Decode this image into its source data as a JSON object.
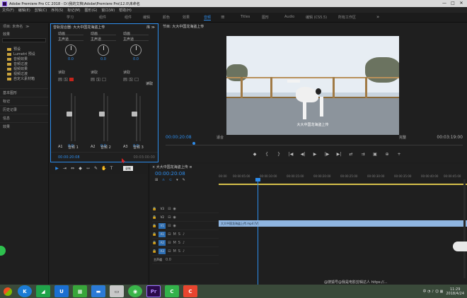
{
  "window": {
    "title": "Adobe Premiere Pro CC 2018 - D:\\我的文档\\Adobe\\Premiere Pro\\12.0\\未命名",
    "controls": [
      "—",
      "□",
      "✕"
    ]
  },
  "menu": [
    "文件(F)",
    "编辑(E)",
    "剪辑(C)",
    "序列(S)",
    "标记(M)",
    "图形(G)",
    "窗口(W)",
    "帮助(H)"
  ],
  "workspaces": {
    "items": [
      "组件",
      "编辑",
      "颜色",
      "效果",
      "音频",
      "Titles",
      "图形",
      "Audio",
      "编辑 (CS5.5)",
      "所有工作区"
    ],
    "active": "音频",
    "left_items": [
      "学习",
      "组件"
    ]
  },
  "project": {
    "tabs": [
      "项目: 未命名",
      "≫"
    ],
    "label": "效果",
    "items": [
      "预设",
      "Lumetri 预设",
      "音频效果",
      "音频过渡",
      "视频效果",
      "视频过渡",
      "自定义素材箱"
    ],
    "sections": [
      "基本图形",
      "标记",
      "历史记录",
      "信息",
      "效果"
    ]
  },
  "mixer": {
    "title": "音轨混合器: 大大中国龙海盗上传",
    "title_suffix": "库 ≫",
    "channels": [
      {
        "read": "读取",
        "drop": "动画",
        "sub": "主声道",
        "pan": "0.0",
        "gain": "0.0",
        "name": "音频 1",
        "id": "A1"
      },
      {
        "read": "读取",
        "drop": "动画",
        "sub": "主声道",
        "pan": "0.0",
        "gain": "0.0",
        "name": "音频 2",
        "id": "A2"
      },
      {
        "read": "读取",
        "drop": "动画",
        "sub": "主声道",
        "pan": "0.0",
        "gain": "0.0",
        "name": "音频 3",
        "id": "A3"
      }
    ],
    "master_read": "读取",
    "timecode": "00:00:20:08",
    "timecode_end": "00:03:00:00",
    "tooltip": "录制"
  },
  "monitor": {
    "title": "节目: 大大中国龙海盗上传",
    "subtitle": "大大中国龙海盗上传",
    "timecode": "00:00:20:08",
    "fit": "适合",
    "quality": "完整",
    "duration": "00:03:19:00",
    "transport": [
      "◆",
      "{",
      "}",
      "|◀",
      "◀|",
      "▶",
      "|▶",
      "▶|",
      "⇄",
      "⇉",
      "▣",
      "⊕",
      "+"
    ]
  },
  "timeline": {
    "title": "× 大大中国龙海盗上传 ≡",
    "timecode": "00:00:20:08",
    "ruler": [
      "00:00",
      "00:00:05:00",
      "00:00:10:00",
      "00:00:15:00",
      "00:00:20:00",
      "00:00:25:00",
      "00:00:30:00",
      "00:00:35:00",
      "00:00:40:00",
      "00:00:45:00"
    ],
    "tracks": [
      {
        "id": "V3",
        "type": "video"
      },
      {
        "id": "V2",
        "type": "video"
      },
      {
        "id": "V1",
        "type": "video"
      },
      {
        "id": "A1",
        "type": "audio"
      },
      {
        "id": "A2",
        "type": "audio"
      },
      {
        "id": "A3",
        "type": "audio"
      },
      {
        "id": "主声道",
        "type": "master",
        "value": "0.0"
      }
    ],
    "clip": "大大中国龙海盗上传.mp4 [V]"
  },
  "tools": [
    "▶",
    "⇥",
    "⇔",
    "◆",
    "⇿",
    "✎",
    "✋",
    "T"
  ],
  "taskbar": {
    "apps": [
      "K",
      "◢",
      "U",
      "▦",
      "▬",
      "▭",
      "◉",
      "Pr",
      "C",
      "C"
    ],
    "time": "11:29",
    "date": "2018/4/24",
    "tray": "中 ◔ ♪ ☺ ▦"
  },
  "watermark": "@搜狐号@我是电影剪辑达人 https://..."
}
